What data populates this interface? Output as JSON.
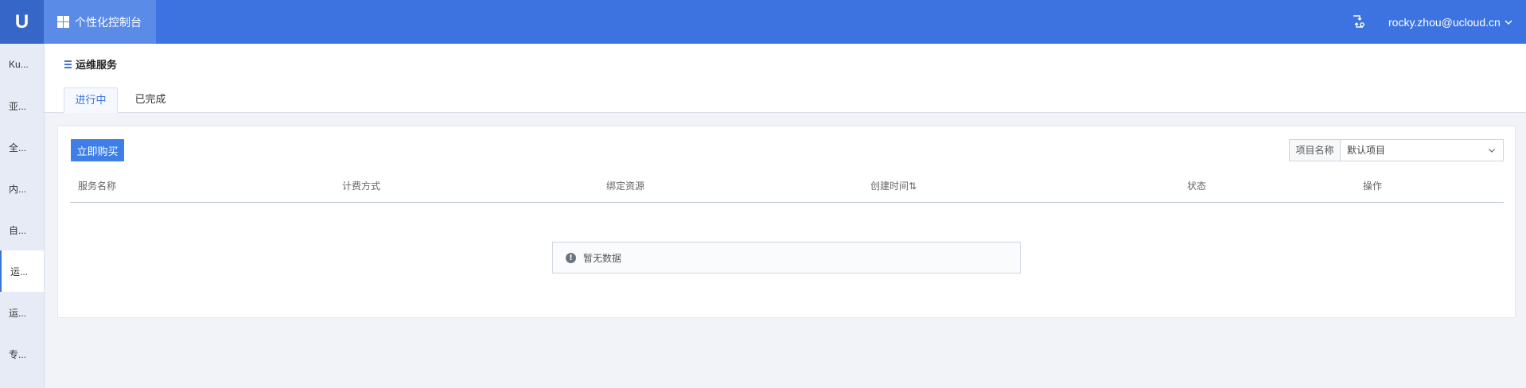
{
  "topbar": {
    "logo_letter": "U",
    "console_label": "个性化控制台",
    "user_email": "rocky.zhou@ucloud.cn",
    "accent": "#3d73e0"
  },
  "sidebar": {
    "items": [
      {
        "label": "Ku..."
      },
      {
        "label": "亚..."
      },
      {
        "label": "全..."
      },
      {
        "label": "内..."
      },
      {
        "label": "自..."
      },
      {
        "label": "运...",
        "active": true
      },
      {
        "label": "运..."
      },
      {
        "label": "专..."
      }
    ]
  },
  "page": {
    "title": "运维服务",
    "tabs": [
      {
        "label": "进行中",
        "active": true
      },
      {
        "label": "已完成",
        "active": false
      }
    ]
  },
  "toolbar": {
    "buy_label": "立即购买",
    "project_label": "项目名称",
    "project_value": "默认项目"
  },
  "table": {
    "columns": [
      "服务名称",
      "计费方式",
      "绑定资源",
      "创建时间⇅",
      "状态",
      "操作"
    ],
    "rows": [],
    "empty_text": "暂无数据"
  },
  "icons": {
    "logo": "ucloud-logo",
    "console": "grid-icon",
    "switch": "switch-account-icon",
    "user_menu": "chevron-down-icon",
    "title": "list-icon",
    "empty": "info-icon"
  }
}
